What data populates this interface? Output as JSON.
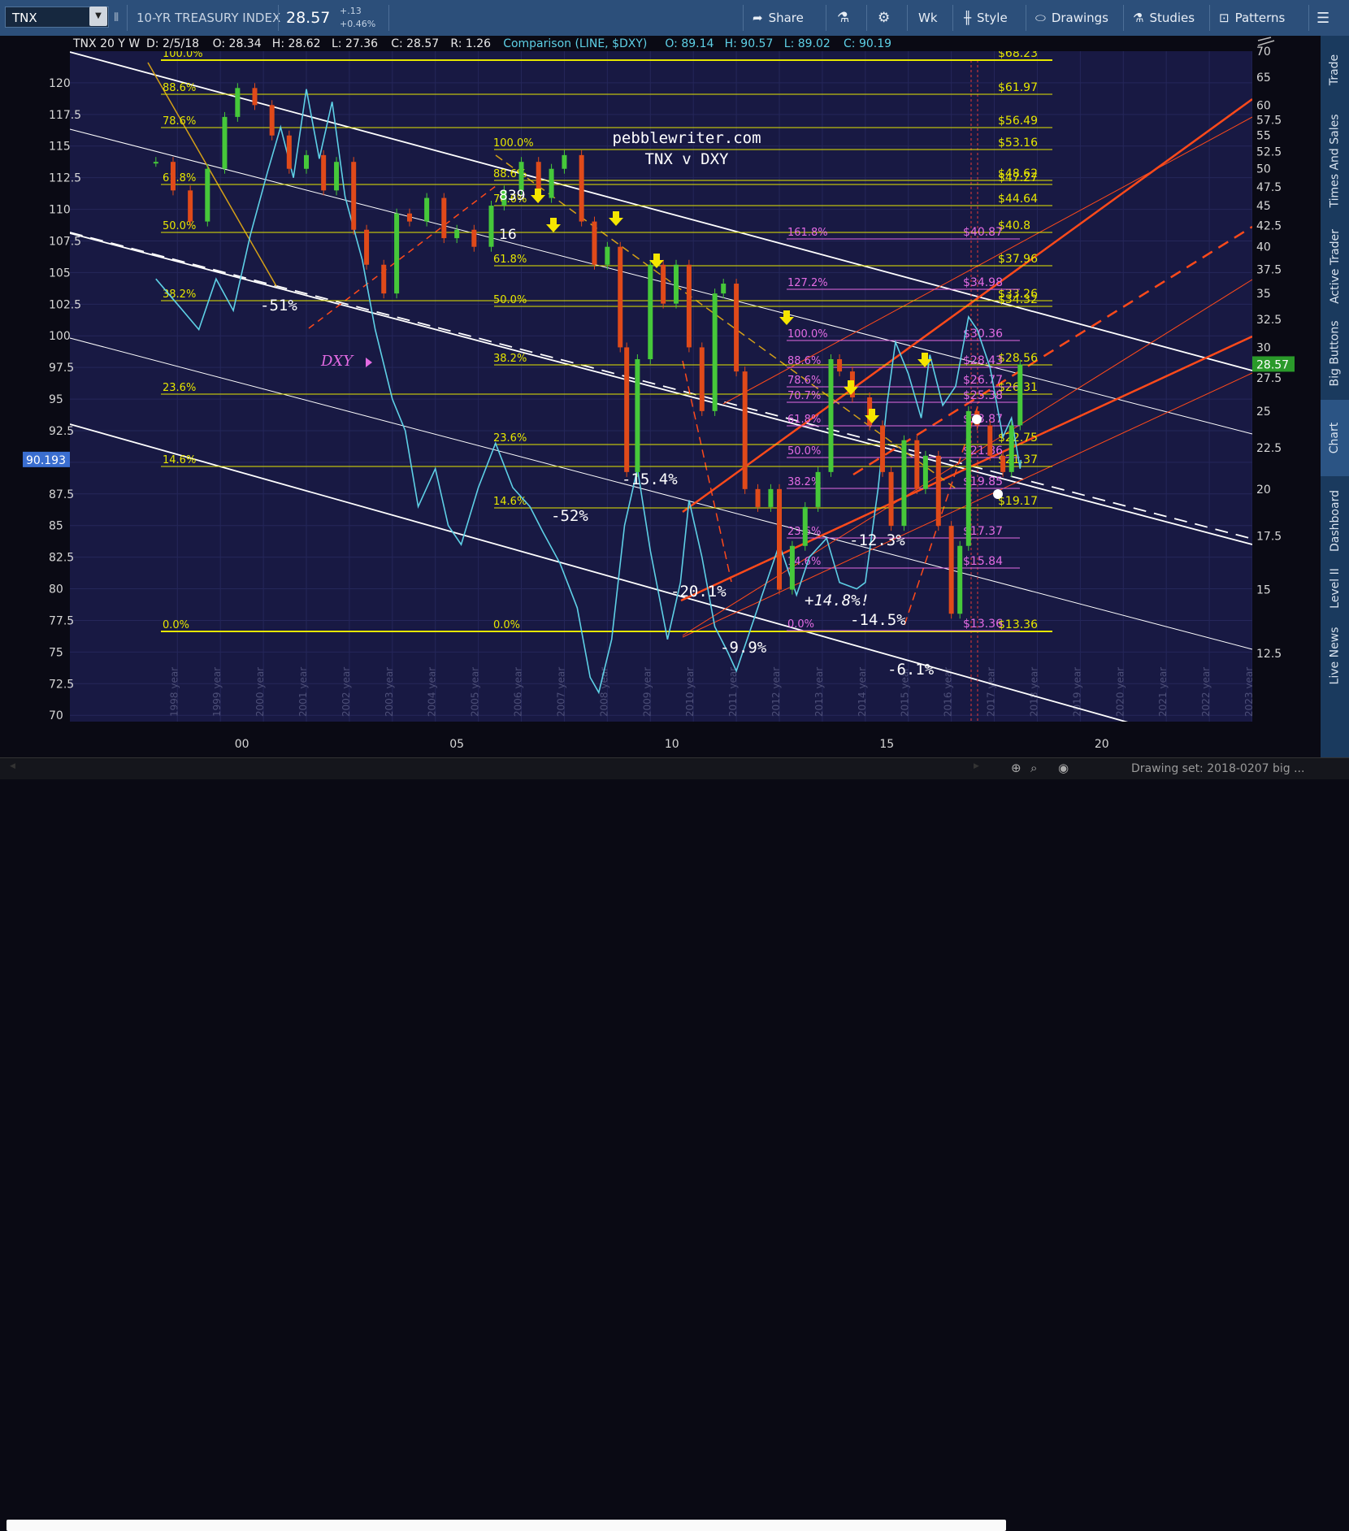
{
  "toolbar": {
    "symbol": "TNX",
    "description": "10-YR TREASURY INDEX",
    "last": "28.57",
    "change": "+.13",
    "change_pct": "+0.46%",
    "aggregation": "Wk",
    "buttons": [
      "Share",
      "Style",
      "Drawings",
      "Studies",
      "Patterns"
    ]
  },
  "legend": {
    "symbol": "TNX 20 Y W",
    "date": "D: 2/5/18",
    "ohlc": [
      "O: 28.34",
      "H: 28.62",
      "L: 27.36",
      "C: 28.57",
      "R: 1.26"
    ],
    "comparison": "Comparison (LINE, $DXY)",
    "comp_ohlc": [
      "O: 89.14",
      "H: 90.57",
      "L: 89.02",
      "C: 90.19"
    ]
  },
  "status": {
    "drawing_set": "Drawing set: 2018-0207 big ..."
  },
  "side_tabs": [
    "Trade",
    "Times And Sales",
    "Active Trader",
    "Big Buttons",
    "Chart",
    "Dashboard",
    "Level II",
    "Live News"
  ],
  "colors": {
    "background": "#181943",
    "price": "#5ed0e6",
    "fib": "#e6e600",
    "fib_magenta": "#e36be3",
    "channel_orange": "#ff4a1a",
    "channel_white": "#ffffff",
    "up_candle": "#46c83a",
    "down_candle": "#e04a1a",
    "tnx_badge": "#2a9a2a",
    "dxy_badge": "#3a6ed0"
  },
  "chart_data": {
    "type": "line",
    "title": "pebblewriter.com",
    "subtitle": "TNX v DXY",
    "x_axis": {
      "range": [
        1996.0,
        2023.5
      ],
      "tick_labels": [
        {
          "x": 2000,
          "label": "00"
        },
        {
          "x": 2005,
          "label": "05"
        },
        {
          "x": 2010,
          "label": "10"
        },
        {
          "x": 2015,
          "label": "15"
        },
        {
          "x": 2020,
          "label": "20"
        }
      ],
      "year_labels": [
        "1998 year",
        "1999 year",
        "2000 year",
        "2001 year",
        "2002 year",
        "2003 year",
        "2004 year",
        "2005 year",
        "2006 year",
        "2007 year",
        "2008 year",
        "2009 year",
        "2010 year",
        "2011 year",
        "2012 year",
        "2013 year",
        "2014 year",
        "2015 year",
        "2016 year",
        "2017 year",
        "2018 year",
        "2019 year",
        "2020 year",
        "2021 year",
        "2022 year",
        "2023 year"
      ]
    },
    "left_axis": {
      "series": "DXY",
      "range": [
        69.5,
        122.5
      ],
      "ticks": [
        "70",
        "72.5",
        "75",
        "77.5",
        "80",
        "82.5",
        "85",
        "87.5",
        "90",
        "92.5",
        "95",
        "97.5",
        "100",
        "102.5",
        "105",
        "107.5",
        "110",
        "112.5",
        "115",
        "117.5",
        "120"
      ],
      "last": "90.193"
    },
    "right_axis": {
      "series": "TNX",
      "ticks": [
        {
          "v": 12.5,
          "label": "12.5"
        },
        {
          "v": 15,
          "label": "15"
        },
        {
          "v": 17.5,
          "label": "17.5"
        },
        {
          "v": 20,
          "label": "20"
        },
        {
          "v": 22.5,
          "label": "22.5"
        },
        {
          "v": 25,
          "label": "25"
        },
        {
          "v": 27.5,
          "label": "27.5"
        },
        {
          "v": 30,
          "label": "30"
        },
        {
          "v": 32.5,
          "label": "32.5"
        },
        {
          "v": 35,
          "label": "35"
        },
        {
          "v": 37.5,
          "label": "37.5"
        },
        {
          "v": 40,
          "label": "40"
        },
        {
          "v": 42.5,
          "label": "42.5"
        },
        {
          "v": 45,
          "label": "45"
        },
        {
          "v": 47.5,
          "label": "47.5"
        },
        {
          "v": 50,
          "label": "50"
        },
        {
          "v": 52.5,
          "label": "52.5"
        },
        {
          "v": 55,
          "label": "55"
        },
        {
          "v": 57.5,
          "label": "57.5"
        },
        {
          "v": 60,
          "label": "60"
        },
        {
          "v": 65,
          "label": "65"
        },
        {
          "v": 70,
          "label": "70"
        }
      ],
      "last": "28.57"
    },
    "series": [
      {
        "name": "$DXY",
        "axis": "left",
        "style": "line",
        "points": [
          [
            1998.0,
            104.5
          ],
          [
            1998.5,
            102.5
          ],
          [
            1999.0,
            100.5
          ],
          [
            1999.4,
            104.5
          ],
          [
            1999.8,
            102.0
          ],
          [
            2000.2,
            108.0
          ],
          [
            2000.6,
            113.0
          ],
          [
            2000.9,
            116.5
          ],
          [
            2001.2,
            112.5
          ],
          [
            2001.5,
            119.5
          ],
          [
            2001.8,
            114.0
          ],
          [
            2002.1,
            118.5
          ],
          [
            2002.4,
            111.0
          ],
          [
            2002.8,
            106.0
          ],
          [
            2003.1,
            100.5
          ],
          [
            2003.5,
            95.0
          ],
          [
            2003.8,
            92.5
          ],
          [
            2004.1,
            86.5
          ],
          [
            2004.5,
            89.5
          ],
          [
            2004.8,
            85.0
          ],
          [
            2005.1,
            83.5
          ],
          [
            2005.5,
            88.0
          ],
          [
            2005.9,
            91.5
          ],
          [
            2006.3,
            88.0
          ],
          [
            2006.7,
            86.5
          ],
          [
            2007.0,
            84.5
          ],
          [
            2007.4,
            82.0
          ],
          [
            2007.8,
            78.5
          ],
          [
            2008.1,
            73.0
          ],
          [
            2008.3,
            71.8
          ],
          [
            2008.6,
            76.0
          ],
          [
            2008.9,
            85.0
          ],
          [
            2009.2,
            89.5
          ],
          [
            2009.5,
            83.0
          ],
          [
            2009.9,
            76.0
          ],
          [
            2010.2,
            80.5
          ],
          [
            2010.4,
            87.0
          ],
          [
            2010.7,
            82.5
          ],
          [
            2011.0,
            77.0
          ],
          [
            2011.3,
            75.0
          ],
          [
            2011.5,
            73.5
          ],
          [
            2011.8,
            76.5
          ],
          [
            2012.1,
            79.5
          ],
          [
            2012.5,
            83.5
          ],
          [
            2012.9,
            79.5
          ],
          [
            2013.2,
            82.5
          ],
          [
            2013.6,
            84.0
          ],
          [
            2013.9,
            80.5
          ],
          [
            2014.3,
            80.0
          ],
          [
            2014.5,
            80.5
          ],
          [
            2014.8,
            88.0
          ],
          [
            2015.0,
            94.5
          ],
          [
            2015.2,
            99.5
          ],
          [
            2015.5,
            97.0
          ],
          [
            2015.8,
            93.5
          ],
          [
            2016.0,
            98.5
          ],
          [
            2016.3,
            94.5
          ],
          [
            2016.6,
            96.0
          ],
          [
            2016.9,
            101.5
          ],
          [
            2017.1,
            100.5
          ],
          [
            2017.4,
            97.5
          ],
          [
            2017.7,
            92.0
          ],
          [
            2017.9,
            93.5
          ],
          [
            2018.1,
            89.5
          ],
          [
            2018.12,
            90.19
          ]
        ]
      },
      {
        "name": "TNX",
        "axis": "right",
        "style": "candles",
        "points": [
          [
            1998.0,
            51
          ],
          [
            1998.4,
            47
          ],
          [
            1998.8,
            43
          ],
          [
            1999.2,
            50
          ],
          [
            1999.6,
            58
          ],
          [
            1999.9,
            63
          ],
          [
            2000.3,
            60
          ],
          [
            2000.7,
            55
          ],
          [
            2001.1,
            50
          ],
          [
            2001.5,
            52
          ],
          [
            2001.9,
            47
          ],
          [
            2002.2,
            51
          ],
          [
            2002.6,
            42
          ],
          [
            2002.9,
            38
          ],
          [
            2003.3,
            35
          ],
          [
            2003.6,
            44
          ],
          [
            2003.9,
            43
          ],
          [
            2004.3,
            46
          ],
          [
            2004.7,
            41
          ],
          [
            2005.0,
            42
          ],
          [
            2005.4,
            40
          ],
          [
            2005.8,
            45
          ],
          [
            2006.1,
            47
          ],
          [
            2006.5,
            51
          ],
          [
            2006.9,
            46
          ],
          [
            2007.2,
            50
          ],
          [
            2007.5,
            52
          ],
          [
            2007.9,
            43
          ],
          [
            2008.2,
            38
          ],
          [
            2008.5,
            40
          ],
          [
            2008.8,
            30
          ],
          [
            2008.95,
            21
          ],
          [
            2009.2,
            29
          ],
          [
            2009.5,
            38
          ],
          [
            2009.8,
            34
          ],
          [
            2010.1,
            38
          ],
          [
            2010.4,
            30
          ],
          [
            2010.7,
            25
          ],
          [
            2011.0,
            35
          ],
          [
            2011.2,
            36
          ],
          [
            2011.5,
            28
          ],
          [
            2011.7,
            20
          ],
          [
            2012.0,
            19
          ],
          [
            2012.3,
            20
          ],
          [
            2012.5,
            15
          ],
          [
            2012.8,
            17
          ],
          [
            2013.1,
            19
          ],
          [
            2013.4,
            21
          ],
          [
            2013.7,
            29
          ],
          [
            2013.9,
            28
          ],
          [
            2014.2,
            26
          ],
          [
            2014.6,
            24
          ],
          [
            2014.9,
            21
          ],
          [
            2015.1,
            18
          ],
          [
            2015.4,
            23
          ],
          [
            2015.7,
            20
          ],
          [
            2015.9,
            22
          ],
          [
            2016.2,
            18
          ],
          [
            2016.5,
            14
          ],
          [
            2016.7,
            17
          ],
          [
            2016.9,
            25
          ],
          [
            2017.1,
            24
          ],
          [
            2017.4,
            22
          ],
          [
            2017.7,
            21
          ],
          [
            2017.9,
            24
          ],
          [
            2018.1,
            28.57
          ]
        ]
      }
    ],
    "fib_levels_left": [
      {
        "label": "100.0%",
        "price": "$68.23"
      },
      {
        "label": "88.6%",
        "price": "$61.97"
      },
      {
        "label": "78.6%",
        "price": "$56.49"
      },
      {
        "label": "61.8%",
        "price": "$47.27"
      },
      {
        "label": "50.0%",
        "price": "$40.8"
      },
      {
        "label": "38.2%",
        "price": "$33.26"
      },
      {
        "label": "23.6%",
        "price": "$26.31"
      },
      {
        "label": "14.6%",
        "price": "$21.37"
      },
      {
        "label": "0.0%",
        "price": "$13.36"
      }
    ],
    "fib_levels_mid": [
      {
        "label": "100.0%",
        "price": "$53.16"
      },
      {
        "label": "88.6%",
        "price": "$48.62"
      },
      {
        "label": "78.6%",
        "price": "$44.64"
      },
      {
        "label": "61.8%",
        "price": "$37.96"
      },
      {
        "label": "50.0%",
        "price": "$34.32"
      },
      {
        "label": "38.2%",
        "price": "$28.56"
      },
      {
        "label": "23.6%",
        "price": "$22.75"
      },
      {
        "label": "14.6%",
        "price": "$19.17"
      },
      {
        "label": "0.0%",
        "price": ""
      }
    ],
    "fib_levels_magenta": [
      {
        "label": "161.8%",
        "price": "$40.87"
      },
      {
        "label": "127.2%",
        "price": "$34.98"
      },
      {
        "label": "100.0%",
        "price": "$30.36"
      },
      {
        "label": "88.6%",
        "price": "$28.43"
      },
      {
        "label": "78.6%",
        "price": "$26.77"
      },
      {
        "label": "70.7%",
        "price": "$25.38"
      },
      {
        "label": "61.8%",
        "price": "$23.87"
      },
      {
        "label": "50.0%",
        "price": "$21.86"
      },
      {
        "label": "38.2%",
        "price": "$19.85"
      },
      {
        "label": "23.6%",
        "price": "$17.37"
      },
      {
        "label": "14.6%",
        "price": "$15.84"
      },
      {
        "label": "0.0%",
        "price": "$13.36"
      }
    ],
    "annotations": {
      "pct_moves": [
        "-51%",
        "-15.4%",
        "-52%",
        "-20.1%",
        "-9.9%",
        "-12.3%",
        "+14.8%!",
        "-14.5%",
        "-6.1%"
      ],
      "dxy_label": "DXY",
      "misc": [
        "16",
        "839"
      ]
    }
  }
}
